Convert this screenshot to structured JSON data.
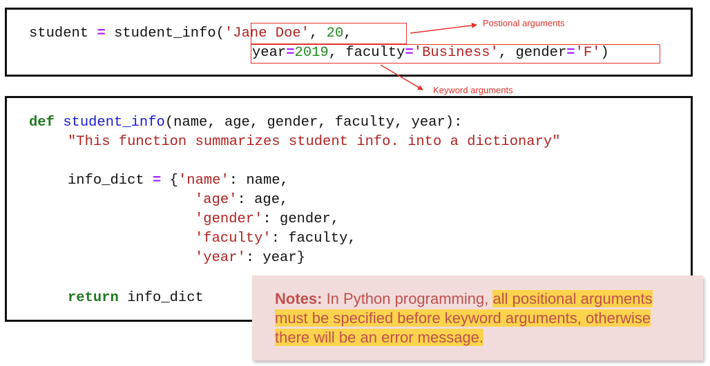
{
  "call_box": {
    "line1": {
      "var": "student",
      "eq": "=",
      "func": "student_info(",
      "arg1": "'Jane Doe'",
      "sep1": ", ",
      "arg2": "20",
      "sep2": ","
    },
    "line2": {
      "k1": "year",
      "eq1": "=",
      "v1": "2019",
      "sep1": ", ",
      "k2": "faculty",
      "eq2": "=",
      "v2": "'Business'",
      "sep2": ", ",
      "k3": "gender",
      "eq3": "=",
      "v3": "'F'",
      "close": ")"
    }
  },
  "annotations": {
    "positional": "Postional arguments",
    "keyword": "Keyword arguments"
  },
  "def_box": {
    "def_kw": "def",
    "func_name": "student_info",
    "params": "(name, age, gender, faculty, year):",
    "docstring": "\"This function summarizes student info. into a dictionary\"",
    "dict_var": "info_dict",
    "dict_eq": "=",
    "dict_open": "{",
    "entries": [
      {
        "key": "'name'",
        "rest": ": name,"
      },
      {
        "key": "'age'",
        "rest": ": age,"
      },
      {
        "key": "'gender'",
        "rest": ": gender,"
      },
      {
        "key": "'faculty'",
        "rest": ": faculty,"
      },
      {
        "key": "'year'",
        "rest": ": year}"
      }
    ],
    "return_kw": "return",
    "return_val": "info_dict"
  },
  "notes": {
    "label": "Notes:",
    "text_plain": " In Python programming, ",
    "text_highlight": "all positional arguments must be specified before keyword arguments, otherwise there will be an error message."
  },
  "colors": {
    "keyword": "#1f7a1f",
    "function": "#1a1ad4",
    "string": "#b22222",
    "number": "#228b22",
    "operator": "#aa22ff",
    "annotation": "#e3322b",
    "notes_bg": "#f2dcdb",
    "notes_text": "#c0504d",
    "highlight": "#fcd34d"
  }
}
